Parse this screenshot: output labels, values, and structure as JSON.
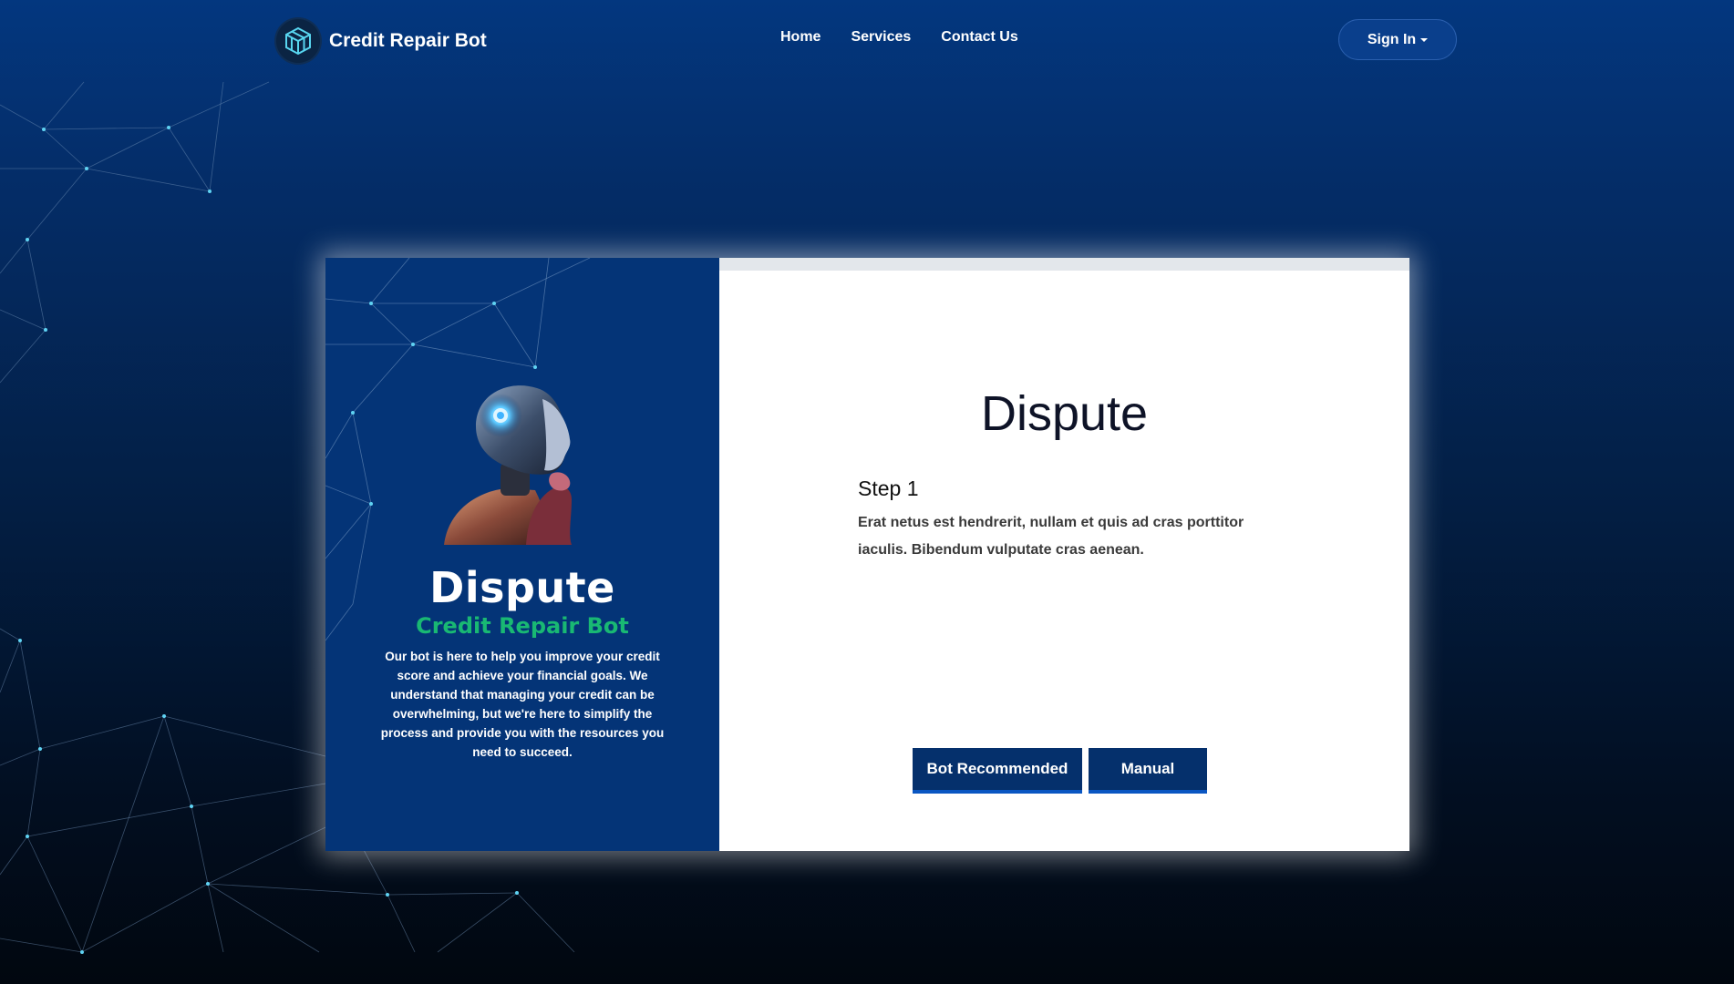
{
  "header": {
    "brand": "Credit Repair Bot",
    "nav": [
      "Home",
      "Services",
      "Contact Us"
    ],
    "signin_label": "Sign In"
  },
  "card": {
    "left": {
      "title": "Dispute",
      "subtitle": "Credit Repair Bot",
      "description": "Our bot is here to help you improve your credit score and achieve your financial goals. We understand that managing your credit can be overwhelming, but we're here to simplify the process and provide you with the resources you need to succeed."
    },
    "right": {
      "title": "Dispute",
      "step_title": "Step 1",
      "step_description": " Erat netus est hendrerit, nullam et quis ad cras porttitor iaculis. Bibendum vulputate cras aenean.",
      "buttons": [
        "Bot Recommended",
        "Manual"
      ]
    }
  },
  "colors": {
    "primary": "#043477",
    "accent_green": "#19b873",
    "button": "#05306c"
  },
  "icons": {
    "logo": "cube-logo-icon",
    "caret": "caret-down-icon",
    "illustration": "robot-illustration"
  }
}
